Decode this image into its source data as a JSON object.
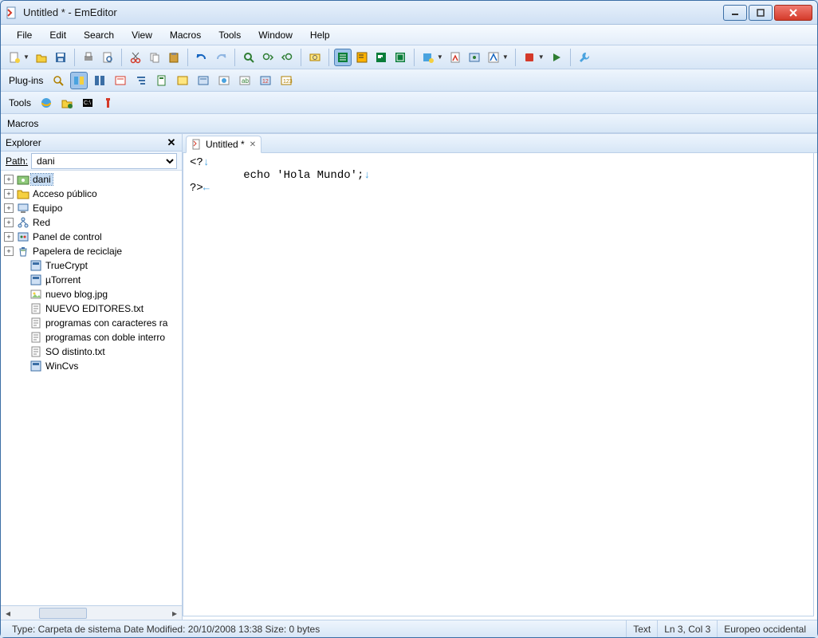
{
  "window": {
    "title": "Untitled * - EmEditor"
  },
  "menu": {
    "items": [
      "File",
      "Edit",
      "Search",
      "View",
      "Macros",
      "Tools",
      "Window",
      "Help"
    ]
  },
  "secondbars": {
    "plugins_label": "Plug-ins",
    "tools_label": "Tools",
    "macros_label": "Macros"
  },
  "explorer": {
    "title": "Explorer",
    "path_label": "Path:",
    "path_value": "dani",
    "tree": [
      {
        "expand": "+",
        "icon": "user-folder",
        "label": "dani",
        "selected": true
      },
      {
        "expand": "+",
        "icon": "folder",
        "label": "Acceso público"
      },
      {
        "expand": "+",
        "icon": "computer",
        "label": "Equipo"
      },
      {
        "expand": "+",
        "icon": "network",
        "label": "Red"
      },
      {
        "expand": "+",
        "icon": "control-panel",
        "label": "Panel de control"
      },
      {
        "expand": "+",
        "icon": "recycle",
        "label": "Papelera de reciclaje"
      },
      {
        "expand": "",
        "icon": "app",
        "label": "TrueCrypt"
      },
      {
        "expand": "",
        "icon": "app",
        "label": "µTorrent"
      },
      {
        "expand": "",
        "icon": "image",
        "label": "nuevo blog.jpg"
      },
      {
        "expand": "",
        "icon": "txt",
        "label": "NUEVO EDITORES.txt"
      },
      {
        "expand": "",
        "icon": "txt",
        "label": "programas con caracteres ra"
      },
      {
        "expand": "",
        "icon": "txt",
        "label": "programas con doble interro"
      },
      {
        "expand": "",
        "icon": "txt",
        "label": "SO distinto.txt"
      },
      {
        "expand": "",
        "icon": "app",
        "label": "WinCvs"
      }
    ]
  },
  "editor": {
    "tab_label": "Untitled *",
    "lines": [
      {
        "text": "<?",
        "eol": "↓"
      },
      {
        "text": "        echo 'Hola Mundo';",
        "eol": "↓"
      },
      {
        "text": "?>",
        "eol": "←"
      }
    ]
  },
  "status": {
    "left": "Type: Carpeta de sistema Date Modified: 20/10/2008 13:38 Size: 0 bytes",
    "mode": "Text",
    "pos": "Ln 3, Col 3",
    "encoding": "Europeo occidental"
  },
  "icons": {
    "new": "new-doc-icon",
    "open": "open-icon",
    "save": "save-icon",
    "print": "print-icon",
    "preview": "preview-icon",
    "cut": "cut-icon",
    "copy": "copy-icon",
    "paste": "paste-icon",
    "undo": "undo-icon",
    "redo": "redo-icon",
    "find": "find-icon",
    "findnext": "find-next-icon",
    "findprev": "find-prev-icon",
    "incsearch": "inc-search-icon",
    "wrap1": "wrap-none-icon",
    "wrap2": "wrap-window-icon",
    "wrap3": "wrap-page-icon",
    "wrap4": "wrap-margin-icon",
    "cfg1": "config-icon",
    "cfg2": "properties-icon",
    "cfg3": "customize-icon",
    "cfg4": "marks-icon",
    "rec": "record-macro-icon",
    "play": "run-macro-icon",
    "tool": "tools-icon"
  }
}
